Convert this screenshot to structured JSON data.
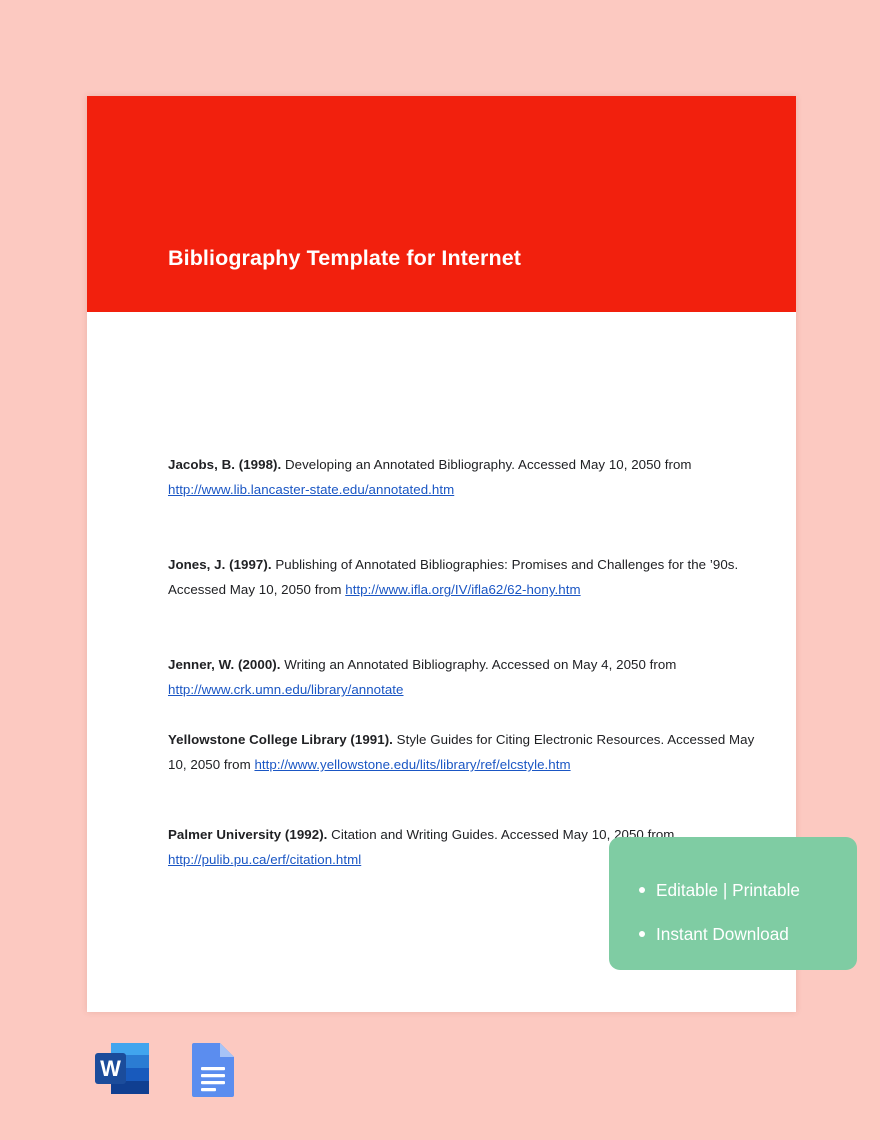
{
  "document": {
    "title": "Bibliography Template for Internet",
    "header_color": "#F2200D",
    "page_background": "#FFFFFF",
    "canvas_background": "#FCC9C1",
    "link_color": "#1A56C4"
  },
  "bibliography": {
    "entries": [
      {
        "id": "jacobs-1998",
        "author": "Jacobs, B.  (1998). ",
        "text_before": " Developing an Annotated Bibliography. Accessed May 10, 2050 from ",
        "link": "http://www.lib.lancaster-state.edu/annotated.htm"
      },
      {
        "id": "jones-1997",
        "author": "Jones, J.  (1997). ",
        "text_before": " Publishing of Annotated Bibliographies:  Promises and  Challenges for the ’90s.  Accessed May 10, 2050 from  ",
        "link": "http://www.ifla.org/IV/ifla62/62-hony.htm"
      },
      {
        "id": "jenner-2000",
        "author": "Jenner, W. (2000). ",
        "text_before": " Writing an Annotated Bibliography.   Accessed on May 4, 2050 from ",
        "link": "http://www.crk.umn.edu/library/annotate"
      },
      {
        "id": "yellowstone-1991",
        "author": "Yellowstone College Library (1991). ",
        "text_before": " Style Guides for Citing Electronic Resources. Accessed May 10, 2050 from ",
        "link": "http://www.yellowstone.edu/lits/library/ref/elcstyle.htm"
      },
      {
        "id": "palmer-1992",
        "author": "Palmer University (1992). ",
        "text_before": " Citation and Writing Guides.  Accessed May 10, 2050 from ",
        "link": "http://pulib.pu.ca/erf/citation.html"
      }
    ]
  },
  "promo": {
    "background_color": "#7FCCA3",
    "lines": [
      "Editable | Printable",
      "Instant Download"
    ]
  },
  "formats": [
    {
      "id": "ms-word",
      "name": "word-document-icon",
      "label": "W"
    },
    {
      "id": "google-docs",
      "name": "google-docs-icon",
      "label": ""
    }
  ]
}
